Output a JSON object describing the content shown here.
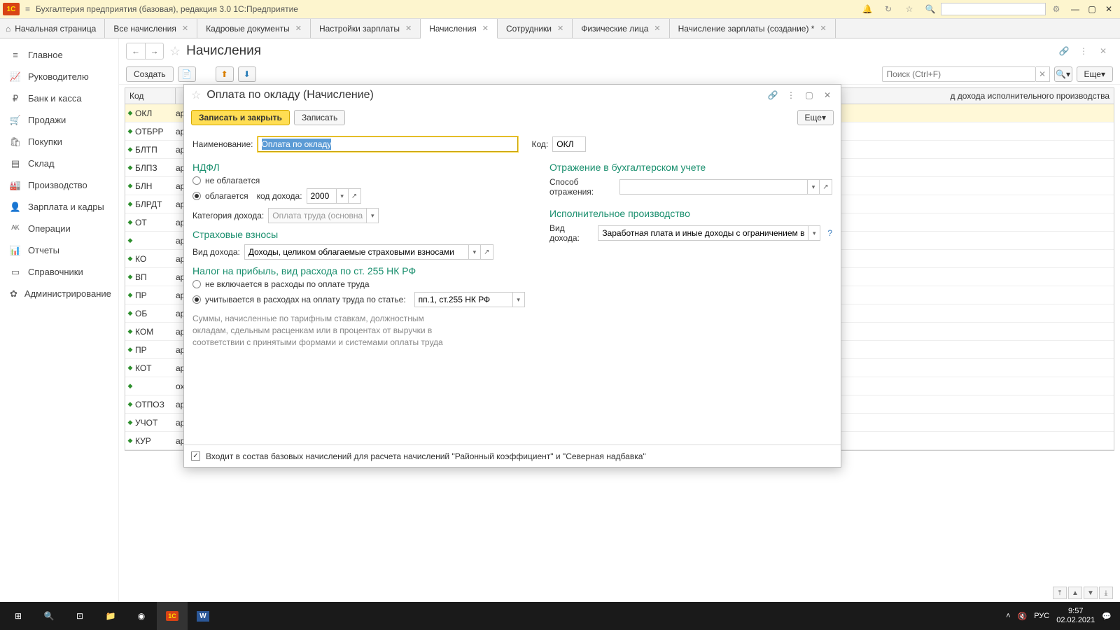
{
  "titlebar": {
    "logo_text": "1С",
    "title": "Бухгалтерия предприятия (базовая), редакция 3.0 1С:Предприятие"
  },
  "tabs": {
    "home": "Начальная страница",
    "items": [
      {
        "label": "Все начисления"
      },
      {
        "label": "Кадровые документы"
      },
      {
        "label": "Настройки зарплаты"
      },
      {
        "label": "Начисления",
        "active": true
      },
      {
        "label": "Сотрудники"
      },
      {
        "label": "Физические лица"
      },
      {
        "label": "Начисление зарплаты (создание) *"
      }
    ]
  },
  "sidebar": {
    "items": [
      {
        "label": "Главное",
        "icon": "≡"
      },
      {
        "label": "Руководителю",
        "icon": "📈"
      },
      {
        "label": "Банк и касса",
        "icon": "₽"
      },
      {
        "label": "Продажи",
        "icon": "🛒"
      },
      {
        "label": "Покупки",
        "icon": "🛍"
      },
      {
        "label": "Склад",
        "icon": "▤"
      },
      {
        "label": "Производство",
        "icon": "🏭"
      },
      {
        "label": "Зарплата и кадры",
        "icon": "👤"
      },
      {
        "label": "Операции",
        "icon": "ᴬᴷ"
      },
      {
        "label": "Отчеты",
        "icon": "📊"
      },
      {
        "label": "Справочники",
        "icon": "▭"
      },
      {
        "label": "Администрирование",
        "icon": "✿"
      }
    ]
  },
  "page": {
    "title": "Начисления",
    "create_btn": "Создать",
    "search_placeholder": "Поиск (Ctrl+F)",
    "more_btn": "Еще",
    "col_code": "Код",
    "col_desc": "д дохода исполнительного производства",
    "rows": [
      {
        "code": "ОКЛ",
        "desc": "аработная плата и иные доходы с огран..."
      },
      {
        "code": "ОТБРР",
        "desc": "аработная плата и иные доходы с огран..."
      },
      {
        "code": "БЛТП",
        "desc": "аработная плата и иные доходы с огран..."
      },
      {
        "code": "БЛПЗ",
        "desc": "аработная плата и иные доходы с огран..."
      },
      {
        "code": "БЛН",
        "desc": "аработная плата и иные доходы с огран..."
      },
      {
        "code": "БЛРДТ",
        "desc": "аработная плата и иные доходы с огран..."
      },
      {
        "code": "ОТ",
        "desc": "аработная плата и иные доходы с огран..."
      },
      {
        "code": "",
        "desc": "аработная плата и иные доходы с огран..."
      },
      {
        "code": "КО",
        "desc": "аработная плата и иные доходы с огран..."
      },
      {
        "code": "ВП",
        "desc": "аработная плата и иные доходы с огран..."
      },
      {
        "code": "ПР",
        "desc": "аработная плата и иные доходы с огран..."
      },
      {
        "code": "ОБ",
        "desc": "аработная плата и иные доходы с огран..."
      },
      {
        "code": "КОМ",
        "desc": "аработная плата и иные доходы с огран..."
      },
      {
        "code": "ПР",
        "desc": "аработная плата и иные доходы с огран..."
      },
      {
        "code": "КОТ",
        "desc": "аработная плата и иные доходы с огран..."
      },
      {
        "code": "",
        "desc": "оходы, на которые не может быть обра..."
      },
      {
        "code": "ОТПОЗ",
        "desc": "аработная плата и иные доходы с огран..."
      },
      {
        "code": "УЧОТ",
        "desc": "аработная плата и иные доходы с огран..."
      },
      {
        "code": "КУР",
        "desc": "аработная плата и иные доходы с огран..."
      }
    ]
  },
  "modal": {
    "title": "Оплата по окладу (Начисление)",
    "save_close": "Записать и закрыть",
    "save": "Записать",
    "more": "Еще",
    "name_label": "Наименование:",
    "name_value": "Оплата по окладу",
    "code_label": "Код:",
    "code_value": "ОКЛ",
    "ndfl_title": "НДФЛ",
    "ndfl_not_taxed": "не облагается",
    "ndfl_taxed": "облагается",
    "ndfl_code_label": "код дохода:",
    "ndfl_code_value": "2000",
    "cat_label": "Категория дохода:",
    "cat_value": "Оплата труда (основная н",
    "ins_title": "Страховые взносы",
    "ins_kind_label": "Вид дохода:",
    "ins_kind_value": "Доходы, целиком облагаемые страховыми взносами",
    "profit_title": "Налог на прибыль, вид расхода по ст. 255 НК РФ",
    "profit_not": "не включается в расходы по оплате труда",
    "profit_yes": "учитывается в расходах на оплату труда по статье:",
    "profit_value": "пп.1, ст.255 НК РФ",
    "help_text": "Суммы, начисленные по тарифным ставкам, должностным окладам, сдельным расценкам или в процентах от выручки в соответствии с принятыми формами и системами оплаты труда",
    "acc_title": "Отражение в бухгалтерском учете",
    "acc_method_label": "Способ отражения:",
    "exec_title": "Исполнительное производство",
    "exec_kind_label": "Вид дохода:",
    "exec_kind_value": "Заработная плата и иные доходы с ограничением взыск",
    "footer_check": "Входит в состав базовых начислений для расчета начислений \"Районный коэффициент\" и \"Северная надбавка\""
  },
  "tray": {
    "lang": "РУС",
    "time": "9:57",
    "date": "02.02.2021"
  }
}
